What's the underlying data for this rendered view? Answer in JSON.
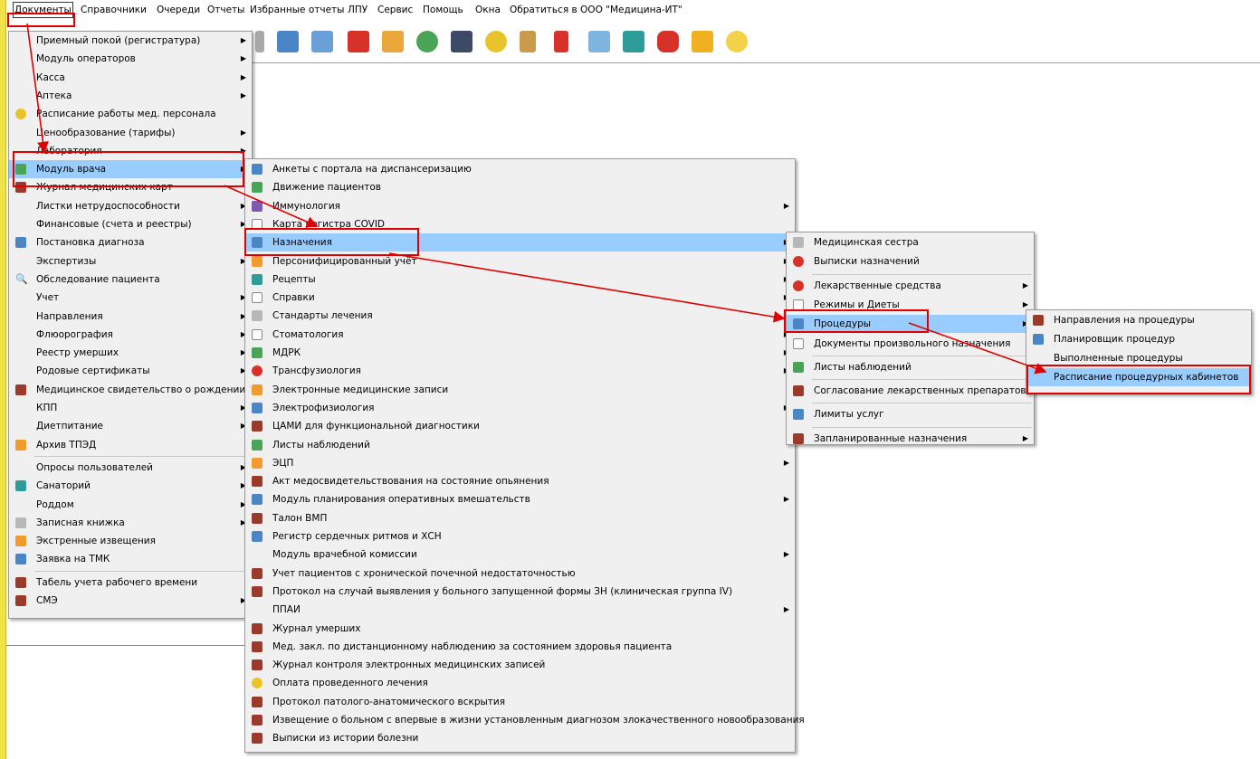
{
  "menubar": {
    "items": [
      "Документы",
      "Справочники",
      "Очереди",
      "Отчеты",
      "Избранные отчеты",
      "ЛПУ",
      "Сервис",
      "Помощь",
      "Окна",
      "Обратиться в ООО \"Медицина-ИТ\""
    ]
  },
  "documents_menu": {
    "items": [
      {
        "label": "Приемный покой (регистратура)",
        "sub": true,
        "icon": "none"
      },
      {
        "label": "Модуль операторов",
        "sub": true,
        "icon": "none"
      },
      {
        "label": "Касса",
        "sub": true,
        "icon": "none"
      },
      {
        "label": "Аптека",
        "sub": true,
        "icon": "none"
      },
      {
        "label": "Расписание работы мед. персонала",
        "sub": false,
        "icon": "schedule-icon"
      },
      {
        "label": "Ценообразование (тарифы)",
        "sub": true,
        "icon": "none"
      },
      {
        "label": "Лаборатория",
        "sub": true,
        "icon": "none"
      },
      {
        "label": "Модуль врача",
        "sub": true,
        "icon": "doctor-icon"
      },
      {
        "label": "Журнал медицинских карт",
        "sub": false,
        "icon": "book-icon"
      },
      {
        "label": "Листки нетрудоспособности",
        "sub": true,
        "icon": "none"
      },
      {
        "label": "Финансовые (счета и реестры)",
        "sub": true,
        "icon": "none"
      },
      {
        "label": "Постановка диагноза",
        "sub": false,
        "icon": "diagnosis-icon"
      },
      {
        "label": "Экспертизы",
        "sub": true,
        "icon": "none"
      },
      {
        "label": "Обследование пациента",
        "sub": false,
        "icon": "magnifier-icon"
      },
      {
        "label": "Учет",
        "sub": true,
        "icon": "none"
      },
      {
        "label": "Направления",
        "sub": true,
        "icon": "none"
      },
      {
        "label": "Флюорография",
        "sub": true,
        "icon": "none"
      },
      {
        "label": "Реестр умерших",
        "sub": true,
        "icon": "none"
      },
      {
        "label": "Родовые сертификаты",
        "sub": true,
        "icon": "none"
      },
      {
        "label": "Медицинское свидетельство о рождении",
        "sub": false,
        "icon": "book-icon"
      },
      {
        "label": "КПП",
        "sub": true,
        "icon": "none"
      },
      {
        "label": "Диетпитание",
        "sub": true,
        "icon": "none"
      },
      {
        "label": "Архив ТПЭД",
        "sub": false,
        "icon": "archive-icon"
      },
      {
        "label": "Опросы пользователей",
        "sub": true,
        "icon": "none"
      },
      {
        "label": "Санаторий",
        "sub": true,
        "icon": "house-icon"
      },
      {
        "label": "Роддом",
        "sub": true,
        "icon": "none"
      },
      {
        "label": "Записная книжка",
        "sub": true,
        "icon": "notebook-icon"
      },
      {
        "label": "Экстренные извещения",
        "sub": false,
        "icon": "alert-icon"
      },
      {
        "label": "Заявка на ТМК",
        "sub": false,
        "icon": "users-icon"
      },
      {
        "label": "Табель учета рабочего времени",
        "sub": false,
        "icon": "book-icon"
      },
      {
        "label": "СМЭ",
        "sub": true,
        "icon": "book-icon"
      }
    ]
  },
  "doctor_menu": {
    "items": [
      {
        "label": "Анкеты с портала на диспансеризацию",
        "sub": false,
        "icon": "form-icon"
      },
      {
        "label": "Движение пациентов",
        "sub": false,
        "icon": "patients-icon"
      },
      {
        "label": "Иммунология",
        "sub": true,
        "icon": "syringe-icon"
      },
      {
        "label": "Карта регистра COVID",
        "sub": false,
        "icon": "card-icon"
      },
      {
        "label": "Назначения",
        "sub": true,
        "icon": "prescription-icon"
      },
      {
        "label": "Персонифицированный учёт",
        "sub": true,
        "icon": "person-record-icon"
      },
      {
        "label": "Рецепты",
        "sub": true,
        "icon": "recipe-icon"
      },
      {
        "label": "Справки",
        "sub": true,
        "icon": "document-icon"
      },
      {
        "label": "Стандарты лечения",
        "sub": true,
        "icon": "standard-icon"
      },
      {
        "label": "Стоматология",
        "sub": true,
        "icon": "tooth-icon"
      },
      {
        "label": "МДРК",
        "sub": true,
        "icon": "mdrk-icon"
      },
      {
        "label": "Трансфузиология",
        "sub": true,
        "icon": "blood-icon"
      },
      {
        "label": "Электронные медицинские записи",
        "sub": false,
        "icon": "emr-icon"
      },
      {
        "label": "Электрофизиология",
        "sub": true,
        "icon": "electro-icon"
      },
      {
        "label": "ЦАМИ для функциональной диагностики",
        "sub": false,
        "icon": "book-icon"
      },
      {
        "label": "Листы наблюдений",
        "sub": false,
        "icon": "observation-icon"
      },
      {
        "label": "ЭЦП",
        "sub": true,
        "icon": "signature-icon"
      },
      {
        "label": "Акт медосвидетельствования на состояние опьянения",
        "sub": false,
        "icon": "book-icon"
      },
      {
        "label": "Модуль планирования оперативных вмешательств",
        "sub": true,
        "icon": "planning-icon"
      },
      {
        "label": "Талон ВМП",
        "sub": false,
        "icon": "book-icon"
      },
      {
        "label": "Регистр сердечных ритмов и ХСН",
        "sub": false,
        "icon": "users-icon"
      },
      {
        "label": "Модуль врачебной комиссии",
        "sub": true,
        "icon": "none"
      },
      {
        "label": "Учет пациентов с хронической почечной недостаточностью",
        "sub": false,
        "icon": "book-icon"
      },
      {
        "label": "Протокол на случай выявления у больного запущенной формы ЗН (клиническая группа IV)",
        "sub": false,
        "icon": "book-icon"
      },
      {
        "label": "ППАИ",
        "sub": true,
        "icon": "none"
      },
      {
        "label": "Журнал умерших",
        "sub": false,
        "icon": "book-icon"
      },
      {
        "label": "Мед. закл. по дистанционному наблюдению за состоянием здоровья пациента",
        "sub": false,
        "icon": "book-icon"
      },
      {
        "label": "Журнал контроля электронных медицинских записей",
        "sub": false,
        "icon": "book-icon"
      },
      {
        "label": "Оплата проведенного лечения",
        "sub": false,
        "icon": "payment-icon"
      },
      {
        "label": "Протокол патолого-анатомического вскрытия",
        "sub": false,
        "icon": "book-icon"
      },
      {
        "label": "Извещение о больном с впервые в жизни установленным диагнозом злокачественного новообразования",
        "sub": false,
        "icon": "book-icon"
      },
      {
        "label": "Выписки из истории болезни",
        "sub": false,
        "icon": "book-icon"
      }
    ]
  },
  "prescriptions_menu": {
    "items": [
      {
        "label": "Медицинская сестра",
        "sub": false,
        "icon": "nurse-icon"
      },
      {
        "label": "Выписки назначений",
        "sub": false,
        "icon": "extract-icon"
      },
      {
        "label": "Лекарственные средства",
        "sub": true,
        "icon": "medicine-icon"
      },
      {
        "label": "Режимы и Диеты",
        "sub": true,
        "icon": "diet-icon"
      },
      {
        "label": "Процедуры",
        "sub": true,
        "icon": "procedure-icon"
      },
      {
        "label": "Документы произвольного назначения",
        "sub": false,
        "icon": "document-icon"
      },
      {
        "label": "Листы наблюдений",
        "sub": false,
        "icon": "observation-icon"
      },
      {
        "label": "Согласование лекарственных препаратов",
        "sub": false,
        "icon": "book-icon"
      },
      {
        "label": "Лимиты услуг",
        "sub": false,
        "icon": "limits-icon"
      },
      {
        "label": "Запланированные назначения",
        "sub": true,
        "icon": "book-icon"
      }
    ]
  },
  "procedures_menu": {
    "items": [
      {
        "label": "Направления на процедуры",
        "sub": false,
        "icon": "book-icon"
      },
      {
        "label": "Планировщик процедур",
        "sub": false,
        "icon": "planner-icon"
      },
      {
        "label": "Выполненные процедуры",
        "sub": false,
        "icon": "none"
      },
      {
        "label": "Расписание процедурных кабинетов",
        "sub": false,
        "icon": "none"
      }
    ]
  },
  "colors": {
    "highlight": "#99ccff",
    "menu_bg": "#f0f0f0",
    "annotation_red": "#e00000",
    "left_strip": "#f2e24a"
  }
}
